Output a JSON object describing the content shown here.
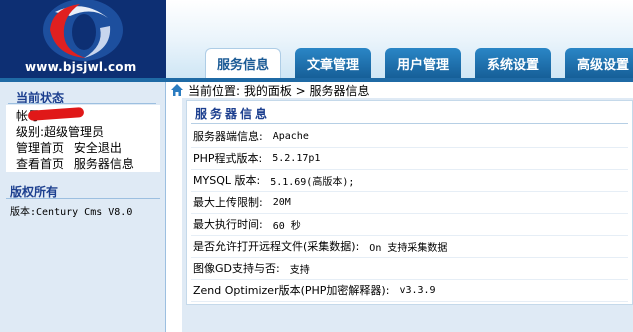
{
  "header": {
    "site_domain": "www.bjsjwl.com",
    "nav_tabs": [
      {
        "label": "服务信息",
        "active": true
      },
      {
        "label": "文章管理",
        "active": false
      },
      {
        "label": "用户管理",
        "active": false
      },
      {
        "label": "系统设置",
        "active": false
      },
      {
        "label": "高级设置",
        "active": false
      }
    ]
  },
  "sidebar": {
    "status_title": "当前状态",
    "account_label": "帐号:",
    "level_text": "级别:超级管理员",
    "links_row1": [
      "管理首页",
      "安全退出"
    ],
    "links_row2": [
      "查看首页",
      "服务器信息"
    ],
    "copyright_title": "版权所有",
    "version_text": "版本:Century Cms V8.0"
  },
  "breadcrumb": {
    "text": "当前位置: 我的面板 > 服务器信息"
  },
  "panel": {
    "title": "服务器信息",
    "rows": [
      {
        "label": "服务器端信息:",
        "value": "Apache"
      },
      {
        "label": "PHP程式版本:",
        "value": "5.2.17p1"
      },
      {
        "label": "MYSQL 版本:",
        "value": "5.1.69(高版本);"
      },
      {
        "label": "最大上传限制:",
        "value": "20M"
      },
      {
        "label": "最大执行时间:",
        "value": "60 秒"
      },
      {
        "label": "是否允许打开远程文件(采集数据):",
        "value": "On 支持采集数据"
      },
      {
        "label": "图像GD支持与否:",
        "value": "支持"
      },
      {
        "label": "Zend Optimizer版本(PHP加密解释器):",
        "value": "v3.3.9"
      }
    ]
  },
  "colors": {
    "accent_blue": "#1f6aa5",
    "title_blue": "#1c3f8f",
    "sidebar_bg": "#dfeaf5",
    "redaction": "#e01818"
  }
}
